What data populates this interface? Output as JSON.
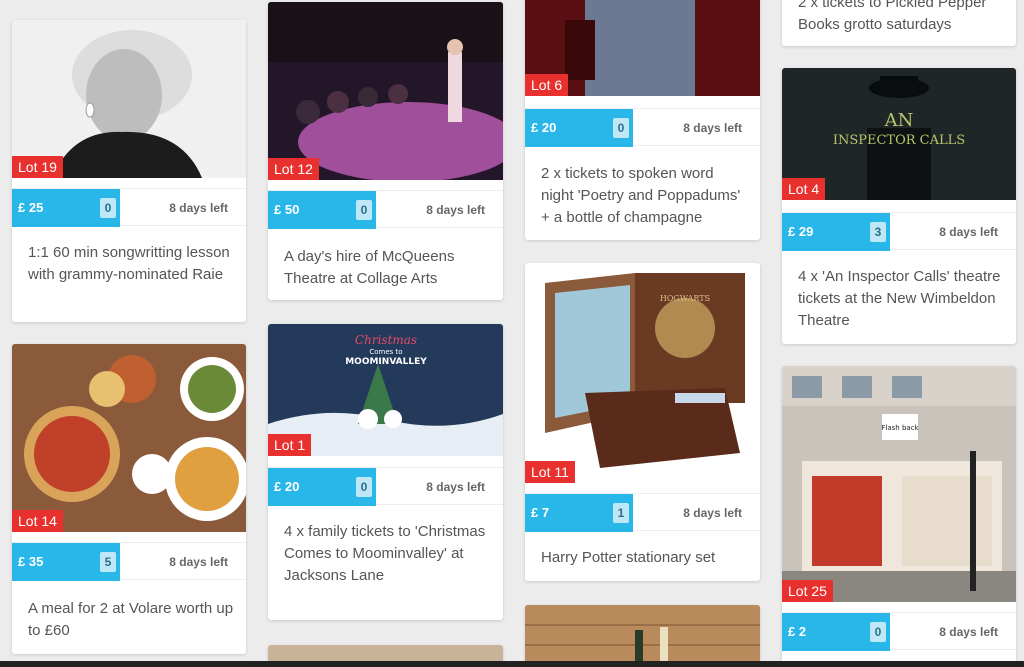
{
  "cards": [
    {
      "lot": "Lot 19",
      "price": "£ 25",
      "bids": "0",
      "days": "8 days left",
      "title": "1:1 60 min songwritting lesson with grammy-nominated Raie"
    },
    {
      "lot": "Lot 12",
      "price": "£ 50",
      "bids": "0",
      "days": "8 days left",
      "title": "A day's hire of McQueens Theatre at Collage Arts"
    },
    {
      "lot": "Lot 6",
      "price": "£ 20",
      "bids": "0",
      "days": "8 days left",
      "title": "2 x tickets to spoken word night 'Poetry and Poppadums' + a bottle of champagne"
    },
    {
      "lot": "",
      "price": "",
      "bids": "",
      "days": "",
      "title": "2 x tickets to Pickled Pepper Books grotto saturdays"
    },
    {
      "lot": "Lot 4",
      "price": "£ 29",
      "bids": "3",
      "days": "8 days left",
      "title": "4 x 'An Inspector Calls' theatre tickets at the New Wimbeldon Theatre"
    },
    {
      "lot": "Lot 14",
      "price": "£ 35",
      "bids": "5",
      "days": "8 days left",
      "title": "A meal for 2 at Volare worth up to £60"
    },
    {
      "lot": "Lot 1",
      "price": "£ 20",
      "bids": "0",
      "days": "8 days left",
      "title": "4 x family tickets to 'Christmas Comes to Moominvalley' at Jacksons Lane"
    },
    {
      "lot": "Lot 11",
      "price": "£ 7",
      "bids": "1",
      "days": "8 days left",
      "title": "Harry Potter stationary set"
    },
    {
      "lot": "Lot 25",
      "price": "£ 2",
      "bids": "0",
      "days": "8 days left",
      "title": ""
    }
  ],
  "image_text": {
    "inspector_line1": "AN",
    "inspector_line2": "INSPECTOR CALLS",
    "moomin_line1": "Christmas",
    "moomin_line2": "Comes to",
    "moomin_line3": "MOOMINVALLEY",
    "hogwarts": "HOGWARTS",
    "flashback": "Flash back"
  }
}
